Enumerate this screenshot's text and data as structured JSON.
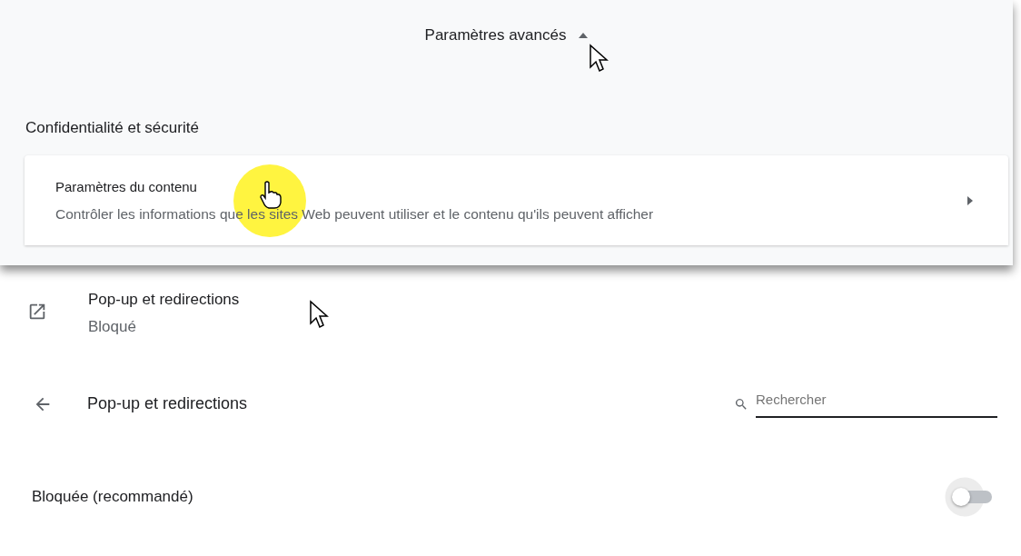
{
  "advanced": {
    "label": "Paramètres avancés",
    "expanded": true
  },
  "section": {
    "title": "Confidentialité et sécurité"
  },
  "content_settings": {
    "title": "Paramètres du contenu",
    "description": "Contrôler les informations que les sites Web peuvent utiliser et le contenu qu'ils peuvent afficher"
  },
  "popup_entry": {
    "title": "Pop-up et redirections",
    "status": "Bloqué"
  },
  "subpage": {
    "title": "Pop-up et redirections",
    "search": {
      "placeholder": "Rechercher"
    }
  },
  "setting": {
    "label": "Bloquée (recommandé)",
    "on": false
  }
}
